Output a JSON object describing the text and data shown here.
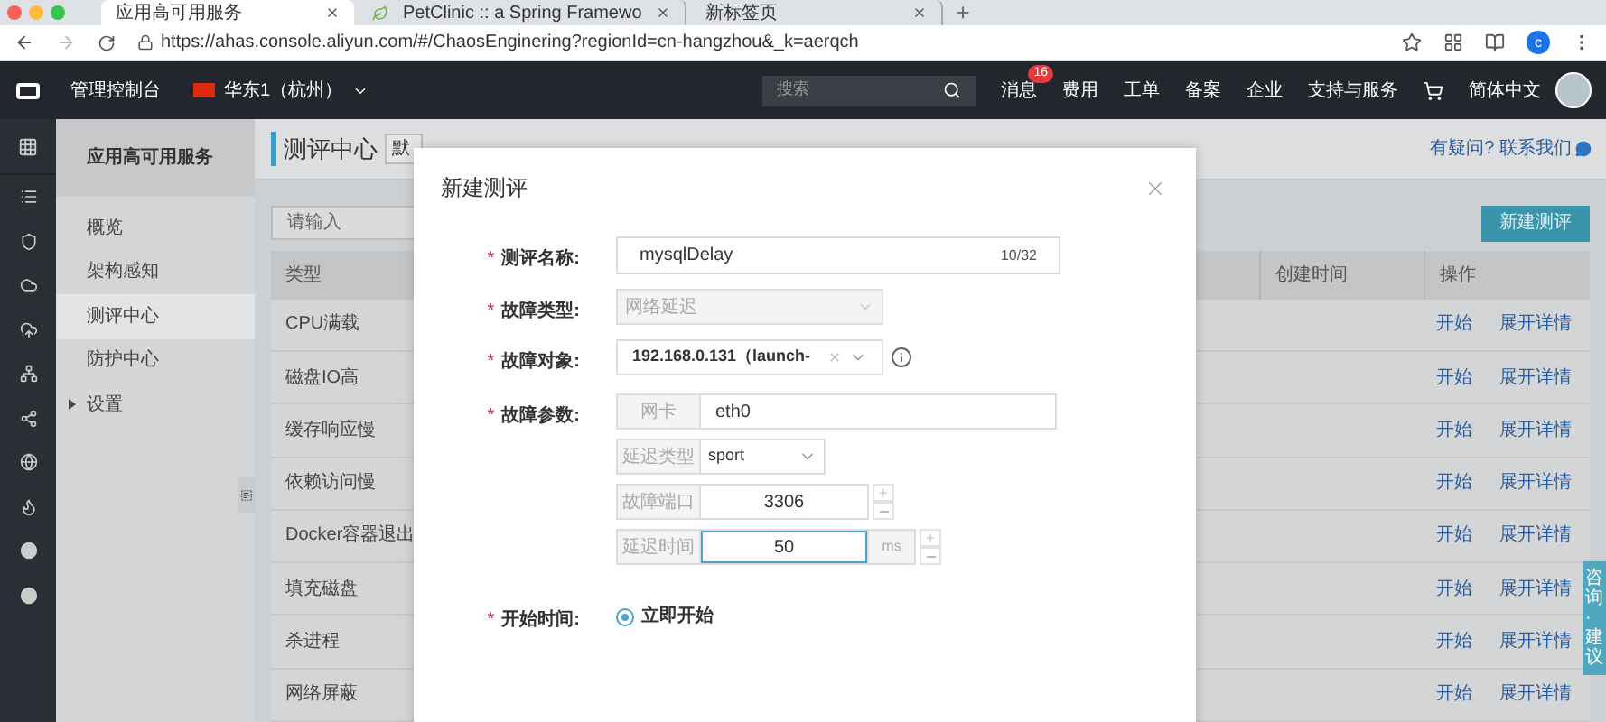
{
  "browser": {
    "tabs": [
      {
        "title": "应用高可用服务",
        "selected": true
      },
      {
        "title": "PetClinic :: a Spring Framewo",
        "selected": false
      },
      {
        "title": "新标签页",
        "selected": false
      }
    ],
    "url": "https://ahas.console.aliyun.com/#/ChaosEnginering?regionId=cn-hangzhou&_k=aerqch",
    "profile_initial": "c"
  },
  "topnav": {
    "console_label": "管理控制台",
    "region": "华东1（杭州）",
    "search_placeholder": "搜索",
    "items": [
      {
        "label": "消息",
        "badge": "16"
      },
      {
        "label": "费用"
      },
      {
        "label": "工单"
      },
      {
        "label": "备案"
      },
      {
        "label": "企业"
      },
      {
        "label": "支持与服务"
      }
    ],
    "language": "简体中文"
  },
  "sidebar": {
    "title": "应用高可用服务",
    "items": [
      {
        "label": "概览",
        "kind": "link",
        "selected": false
      },
      {
        "label": "架构感知",
        "kind": "link",
        "selected": false
      },
      {
        "label": "测评中心",
        "kind": "link",
        "selected": true
      },
      {
        "label": "防护中心",
        "kind": "link",
        "selected": false
      },
      {
        "label": "设置",
        "kind": "group",
        "selected": false,
        "expanded": false
      }
    ]
  },
  "main": {
    "title": "测评中心",
    "view_select": "默",
    "help_link": "有疑问? 联系我们",
    "search_placeholder": "请输入",
    "new_button": "新建测评",
    "columns": [
      "类型",
      "创建时间",
      "操作"
    ],
    "rows": [
      {
        "type": "CPU满载",
        "actions": [
          "开始",
          "展开详情"
        ]
      },
      {
        "type": "磁盘IO高",
        "actions": [
          "开始",
          "展开详情"
        ]
      },
      {
        "type": "缓存响应慢",
        "actions": [
          "开始",
          "展开详情"
        ]
      },
      {
        "type": "依赖访问慢",
        "actions": [
          "开始",
          "展开详情"
        ]
      },
      {
        "type": "Docker容器退出",
        "actions": [
          "开始",
          "展开详情"
        ]
      },
      {
        "type": "填充磁盘",
        "actions": [
          "开始",
          "展开详情"
        ]
      },
      {
        "type": "杀进程",
        "actions": [
          "开始",
          "展开详情"
        ]
      },
      {
        "type": "网络屏蔽",
        "actions": [
          "开始",
          "展开详情"
        ]
      }
    ]
  },
  "feedback_tab": "咨询·建议",
  "modal": {
    "title": "新建测评",
    "required_mark": "*",
    "fields": [
      {
        "kind": "text",
        "label": "测评名称:",
        "required": true,
        "value": "mysqlDelay",
        "counter": "10/32"
      },
      {
        "kind": "select",
        "label": "故障类型:",
        "required": true,
        "value": "网络延迟",
        "disabled": true
      },
      {
        "kind": "target",
        "label": "故障对象:",
        "required": true,
        "value": "192.168.0.131（launch-"
      },
      {
        "kind": "params",
        "label": "故障参数:",
        "required": true,
        "params": [
          {
            "kind": "text",
            "addon": "网卡",
            "value": "eth0"
          },
          {
            "kind": "select",
            "addon": "延迟类型",
            "value": "sport"
          },
          {
            "kind": "number",
            "addon": "故障端口",
            "value": "3306",
            "focused": false
          },
          {
            "kind": "number",
            "addon": "延迟时间",
            "value": "50",
            "suffix": "ms",
            "focused": true
          }
        ]
      },
      {
        "kind": "radio",
        "label": "开始时间:",
        "required": true,
        "options": [
          {
            "label": "立即开始",
            "selected": true
          }
        ]
      }
    ]
  }
}
